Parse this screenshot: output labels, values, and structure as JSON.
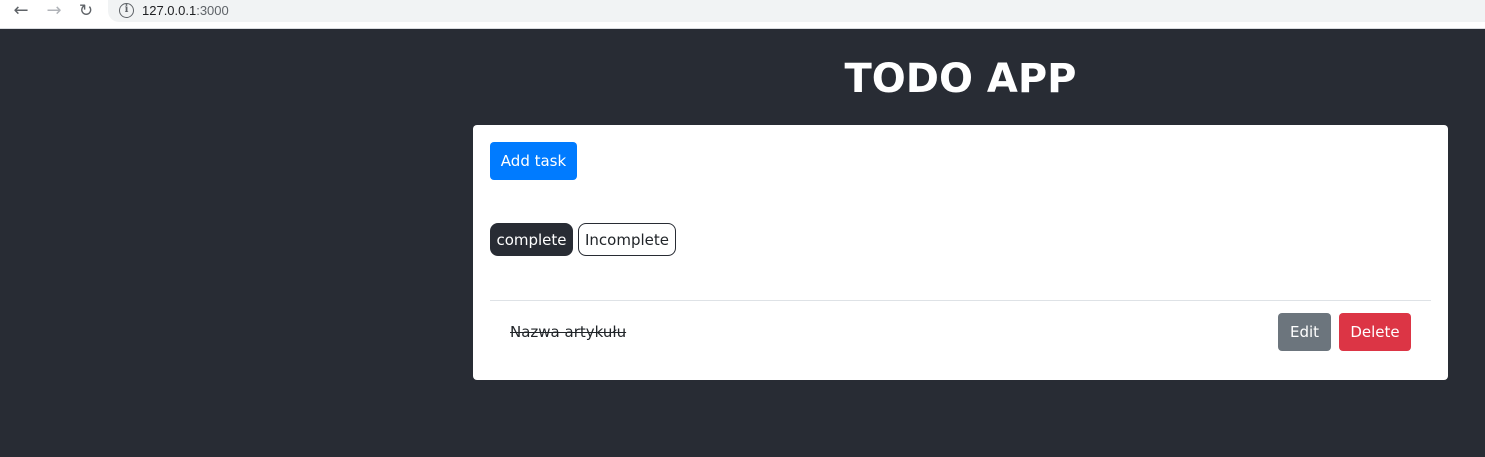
{
  "browser": {
    "back_icon": "←",
    "forward_icon": "→",
    "reload_icon": "↻",
    "info_icon": "i",
    "url_host": "127.0.0.1",
    "url_port": ":3000"
  },
  "app": {
    "title": "TODO APP",
    "add_task_label": "Add task",
    "filters": {
      "complete_label": "complete",
      "incomplete_label": "Incomplete",
      "active": "complete"
    },
    "tasks": [
      {
        "name": "Nazwa artykułu",
        "completed": true,
        "edit_label": "Edit",
        "delete_label": "Delete"
      }
    ]
  },
  "colors": {
    "background": "#282c34",
    "primary": "#007bff",
    "secondary": "#6c757d",
    "danger": "#dc3545"
  }
}
